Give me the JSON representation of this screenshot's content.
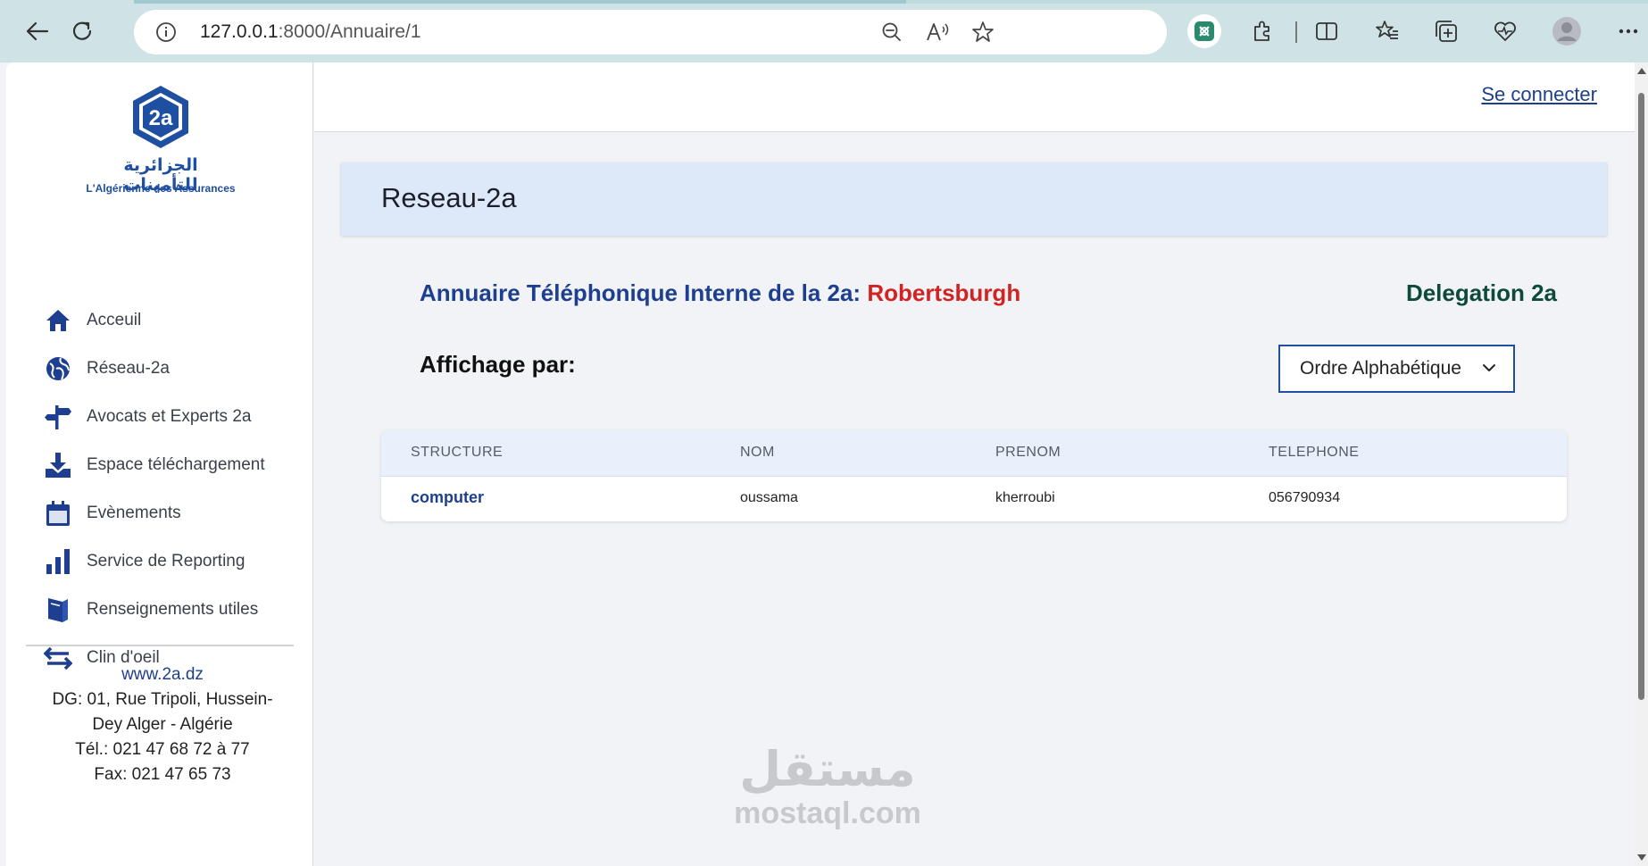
{
  "browser": {
    "url_host": "127.0.0.1",
    "url_path": ":8000/Annuaire/1"
  },
  "sidebar": {
    "logo_arabic": "الجزائرية للتأمينات",
    "logo_french": "L'Algérienne des Assurances",
    "logo_mark": "2a",
    "items": [
      {
        "label": "Acceuil",
        "icon": "home-icon"
      },
      {
        "label": "Réseau-2a",
        "icon": "globe-icon"
      },
      {
        "label": "Avocats et Experts 2a",
        "icon": "signpost-icon"
      },
      {
        "label": "Espace téléchargement",
        "icon": "download-icon"
      },
      {
        "label": "Evènements",
        "icon": "calendar-icon"
      },
      {
        "label": "Service de Reporting",
        "icon": "bar-chart-icon"
      },
      {
        "label": "Renseignements utiles",
        "icon": "book-icon"
      },
      {
        "label": "Clin d'oeil",
        "icon": "exchange-icon"
      }
    ],
    "contact": {
      "website": "www.2a.dz",
      "address_line1": "DG: 01, Rue Tripoli, Hussein-",
      "address_line2": "Dey Alger - Algérie",
      "phone": "Tél.: 021 47 68 72 à 77",
      "fax": "Fax: 021 47 65 73"
    }
  },
  "topbar": {
    "login_label": "Se connecter"
  },
  "banner": {
    "title": "Reseau-2a"
  },
  "main": {
    "heading_prefix": "Annuaire Téléphonique Interne de la 2a: ",
    "heading_city": "Robertsburgh",
    "delegation": "Delegation 2a",
    "affichage_label": "Affichage par:",
    "sort_selected": "Ordre Alphabétique"
  },
  "table": {
    "headers": [
      "STRUCTURE",
      "NOM",
      "PRENOM",
      "TELEPHONE"
    ],
    "rows": [
      {
        "structure": "computer",
        "nom": "oussama",
        "prenom": "kherroubi",
        "telephone": "056790934"
      }
    ]
  },
  "watermark": {
    "arabic": "مستقل",
    "latin": "mostaql.com"
  },
  "colors": {
    "accent": "#1e3f8f",
    "city": "#d32222",
    "delegation": "#0e4a3a",
    "banner_bg": "#dde9f9"
  }
}
